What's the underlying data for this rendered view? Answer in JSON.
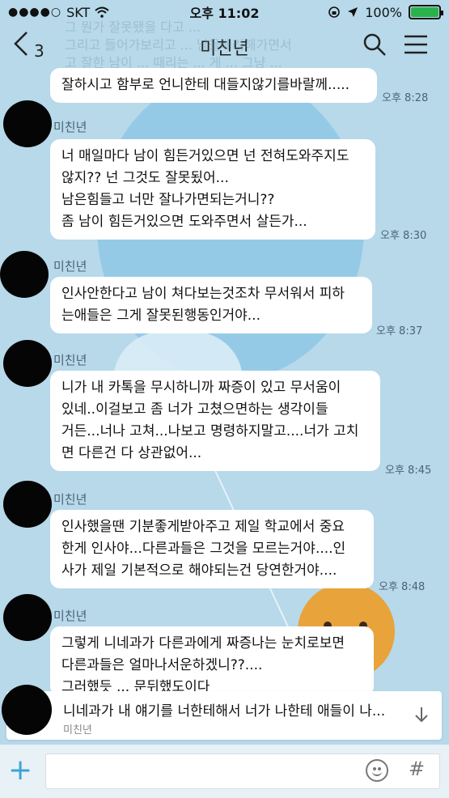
{
  "status_bar": {
    "carrier": "SKT",
    "time": "오후 11:02",
    "battery": "100%",
    "battery_level": 1.0
  },
  "header": {
    "back_count": "3",
    "title": "미친년"
  },
  "ghost_lines": [
    "그 뭔가 잘못됐을 다고 ...",
    "그리고 들어가보리고 ... 남을배려해가면서",
    "고 잘한 남이 ... 때리는 ... 게 ... 그냥 ..."
  ],
  "messages": [
    {
      "sender": "",
      "text": "잘하시고 함부로 언니한테 대들지않기를바랄께.....",
      "time": "오후 8:28"
    },
    {
      "sender": "미친년",
      "text": "너 매일마다 남이 힘든거있으면 넌 전혀도와주지도\n않지?? 넌 그것도 잘못됬어...\n남은힘들고 너만 잘나가면되는거니??\n좀 남이 힘든거있으면 도와주면서 살든가...",
      "time": "오후 8:30"
    },
    {
      "sender": "미친년",
      "text": "인사안한다고 남이 쳐다보는것조차 무서워서 피하\n는애들은 그게 잘못된행동인거야...",
      "time": "오후 8:37"
    },
    {
      "sender": "미친년",
      "text": "니가 내 카톡을 무시하니까 짜증이 있고 무서움이\n있네..이걸보고 좀 너가 고쳤으면하는 생각이들\n거든...너나 고쳐...나보고 명령하지말고....너가 고치\n면 다른건 다 상관없어...",
      "time": "오후 8:45"
    },
    {
      "sender": "미친년",
      "text": "인사했을땐 기분좋게받아주고 제일 학교에서 중요\n한게 인사야...다른과들은 그것을 모르는거야....인\n사가 제일 기본적으로 해야되는건 당연한거야....",
      "time": "오후 8:48"
    },
    {
      "sender": "미친년",
      "text": "그렇게 니네과가 다른과에게 짜증나는 눈치로보면\n다른과들은 얼마나서운하겠니??....\n그러했듯 ... 문뒤했도이다",
      "time": ""
    }
  ],
  "notification": {
    "text": "니네과가 내 얘기를 너한테해서 너가 나한테 애들이 나...",
    "sender": "미친년"
  },
  "icons": {
    "back": "chevron-left-icon",
    "search": "search-icon",
    "menu": "menu-icon",
    "plus": "plus-icon",
    "emoji": "emoji-icon",
    "hash": "hash-icon",
    "scroll_down": "arrow-down-icon"
  },
  "colors": {
    "background": "#b7d9ea",
    "accent": "#3ca3d9",
    "bubble": "#ffffff"
  }
}
